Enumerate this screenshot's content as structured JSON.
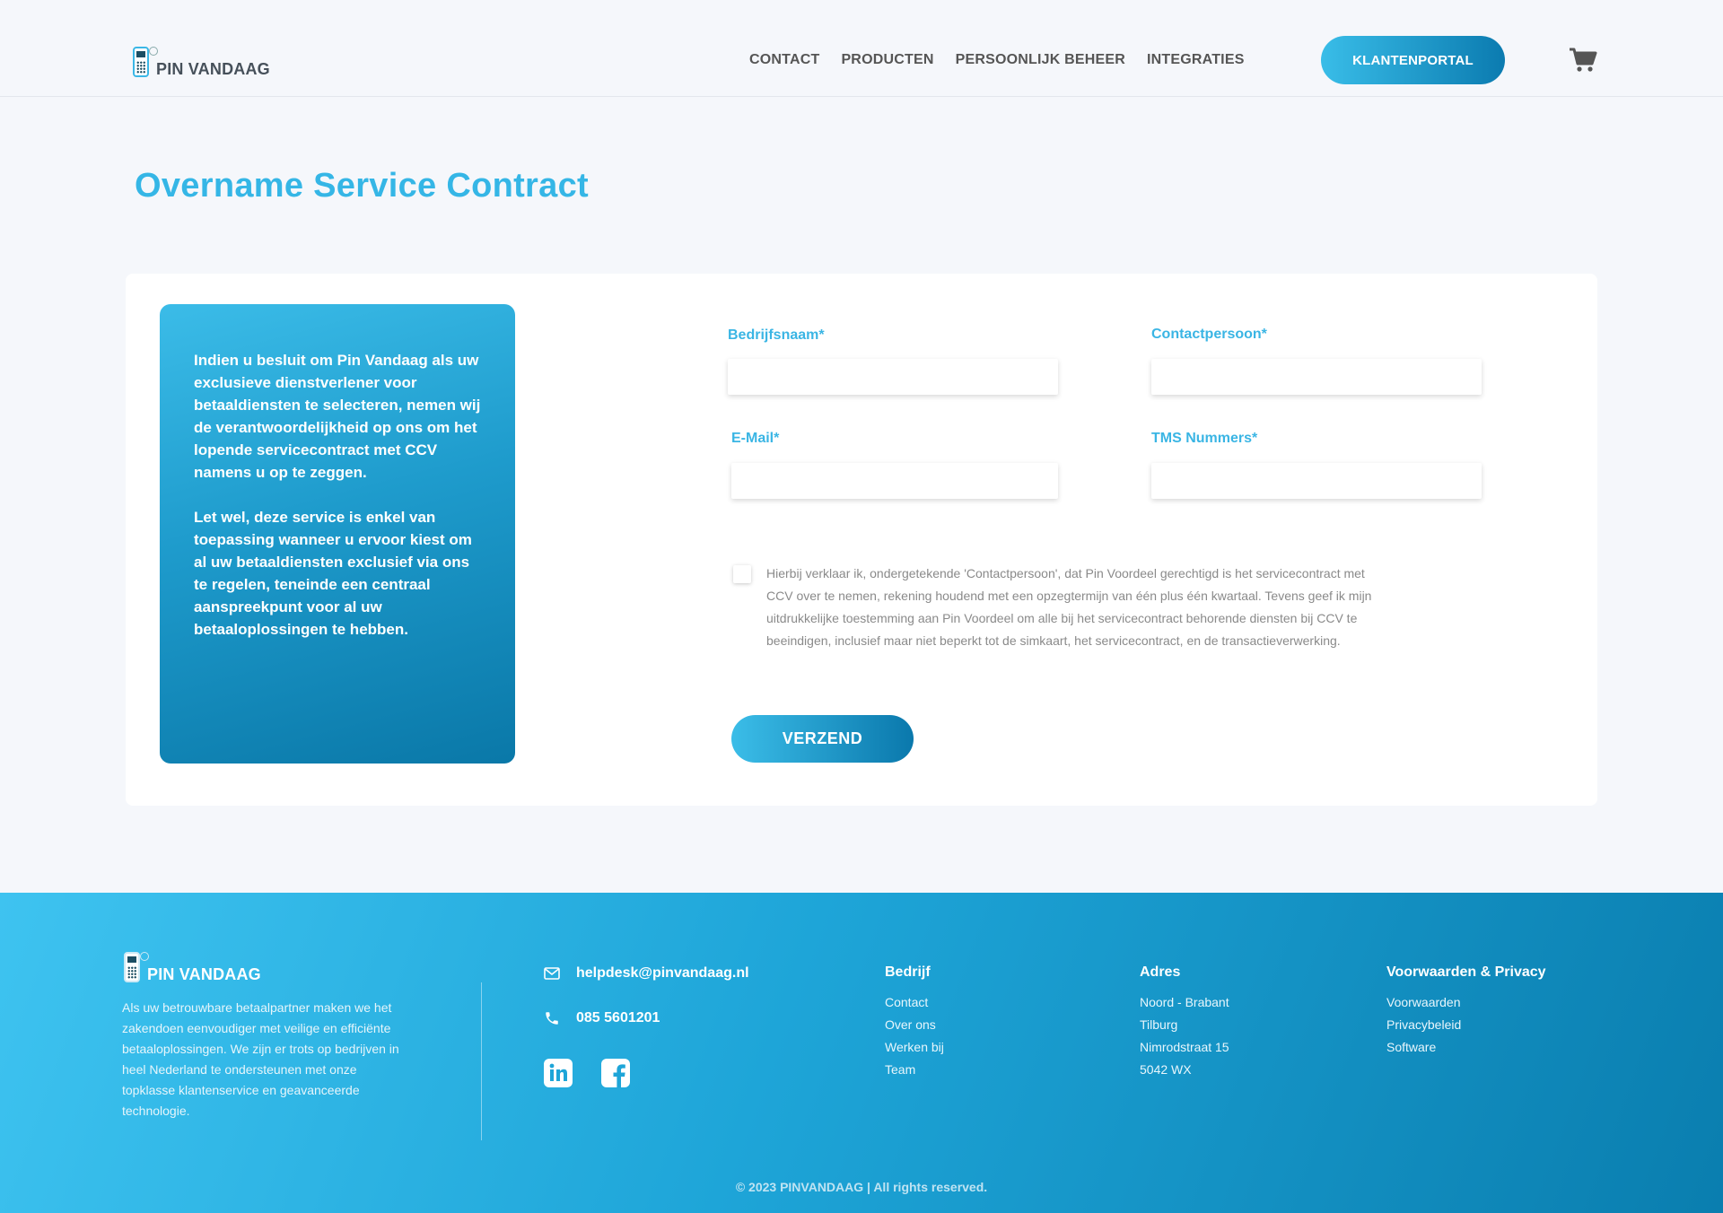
{
  "header": {
    "logo_text": "PIN VANDAAG",
    "nav": [
      "CONTACT",
      "PRODUCTEN",
      "PERSOONLIJK BEHEER",
      "INTEGRATIES"
    ],
    "portal_button": "KLANTENPORTAL",
    "cart_icon": "shopping-cart-icon"
  },
  "page": {
    "title": "Overname Service Contract"
  },
  "info_box": {
    "paragraph_1": "Indien u besluit om Pin Vandaag als uw exclusieve dienstverlener voor betaaldiensten te selecteren, nemen wij de verantwoordelijkheid op ons om het lopende servicecontract met CCV namens u op te zeggen.",
    "paragraph_2": "Let wel, deze service is enkel van toepassing wanneer u ervoor kiest om al uw betaaldiensten exclusief via ons te regelen, teneinde een centraal aanspreekpunt voor al uw betaaloplossingen te hebben."
  },
  "form": {
    "company_label": "Bedrijfsnaam*",
    "company_value": "",
    "contact_label": "Contactpersoon*",
    "contact_value": "",
    "email_label": "E-Mail*",
    "email_value": "",
    "tms_label": "TMS Nummers*",
    "tms_value": "",
    "consent_checked": false,
    "consent_text": "Hierbij verklaar ik, ondergetekende 'Contactpersoon', dat Pin Voordeel gerechtigd is het servicecontract met CCV over te nemen, rekening houdend met een opzegtermijn van één plus één kwartaal. Tevens geef ik mijn uitdrukkelijke toestemming aan Pin Voordeel om alle bij het servicecontract behorende diensten bij CCV te beeindigen, inclusief maar niet beperkt tot de simkaart, het servicecontract, en de transactieverwerking.",
    "submit_label": "VERZEND"
  },
  "footer": {
    "logo_text": "PIN VANDAAG",
    "about": "Als uw betrouwbare betaalpartner maken we het zakendoen eenvoudiger met veilige en efficiënte betaaloplossingen. We zijn er trots op bedrijven in heel Nederland te ondersteunen met onze topklasse klantenservice en geavanceerde technologie.",
    "email": "helpdesk@pinvandaag.nl",
    "phone": "085 5601201",
    "social_icons": [
      "linkedin-icon",
      "facebook-icon"
    ],
    "columns": [
      {
        "title": "Bedrijf",
        "items": [
          "Contact",
          "Over ons",
          "Werken bij",
          "Team"
        ]
      },
      {
        "title": "Adres",
        "items": [
          "Noord - Brabant",
          "Tilburg",
          "Nimrodstraat 15",
          "5042 WX"
        ]
      },
      {
        "title": "Voorwaarden & Privacy",
        "items": [
          "Voorwaarden",
          "Privacybeleid",
          "Software"
        ]
      }
    ],
    "copyright": "© 2023 PINVANDAAG | All rights reserved."
  },
  "colors": {
    "accent": "#35b6e6",
    "accent_dark": "#0a78a8",
    "background": "#f5f7fb"
  }
}
